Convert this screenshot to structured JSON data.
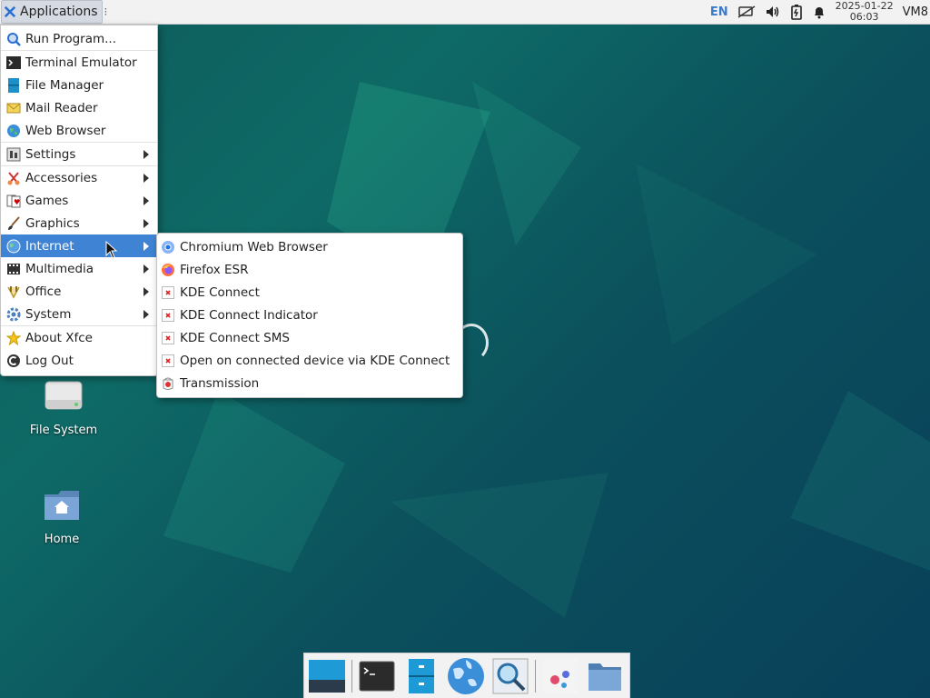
{
  "top_panel": {
    "applications_label": "Applications",
    "language": "EN",
    "clock_date": "2025-01-22",
    "clock_time": "06:03",
    "hostname": "VM8"
  },
  "menu": {
    "items": [
      {
        "label": "Run Program...",
        "icon": "run-program-icon"
      },
      {
        "label": "Terminal Emulator",
        "icon": "terminal-icon"
      },
      {
        "label": "File Manager",
        "icon": "file-manager-icon"
      },
      {
        "label": "Mail Reader",
        "icon": "mail-icon"
      },
      {
        "label": "Web Browser",
        "icon": "web-browser-icon"
      },
      {
        "label": "Settings",
        "icon": "settings-icon",
        "submenu": true
      },
      {
        "label": "Accessories",
        "icon": "accessories-icon",
        "submenu": true
      },
      {
        "label": "Games",
        "icon": "games-icon",
        "submenu": true
      },
      {
        "label": "Graphics",
        "icon": "graphics-icon",
        "submenu": true
      },
      {
        "label": "Internet",
        "icon": "internet-icon",
        "submenu": true,
        "active": true
      },
      {
        "label": "Multimedia",
        "icon": "multimedia-icon",
        "submenu": true
      },
      {
        "label": "Office",
        "icon": "office-icon",
        "submenu": true
      },
      {
        "label": "System",
        "icon": "system-icon",
        "submenu": true
      },
      {
        "label": "About Xfce",
        "icon": "star-icon"
      },
      {
        "label": "Log Out",
        "icon": "logout-icon"
      }
    ]
  },
  "submenu_internet": {
    "items": [
      {
        "label": "Chromium Web Browser",
        "icon": "chromium-icon"
      },
      {
        "label": "Firefox ESR",
        "icon": "firefox-icon"
      },
      {
        "label": "KDE Connect",
        "icon": "missing-icon"
      },
      {
        "label": "KDE Connect Indicator",
        "icon": "missing-icon"
      },
      {
        "label": "KDE Connect SMS",
        "icon": "missing-icon"
      },
      {
        "label": "Open on connected device via KDE Connect",
        "icon": "missing-icon"
      },
      {
        "label": "Transmission",
        "icon": "transmission-icon"
      }
    ]
  },
  "desktop_icons": [
    {
      "label": "File System",
      "icon": "drive-icon"
    },
    {
      "label": "Home",
      "icon": "home-folder-icon"
    }
  ],
  "dock": {
    "items": [
      "show-desktop-icon",
      "terminal-icon",
      "file-manager-icon",
      "web-browser-icon",
      "app-finder-icon",
      "user-apps-icon",
      "folder-icon"
    ]
  },
  "colors": {
    "menu_highlight": "#3f84d4",
    "panel_bg": "#f2f2f2"
  }
}
